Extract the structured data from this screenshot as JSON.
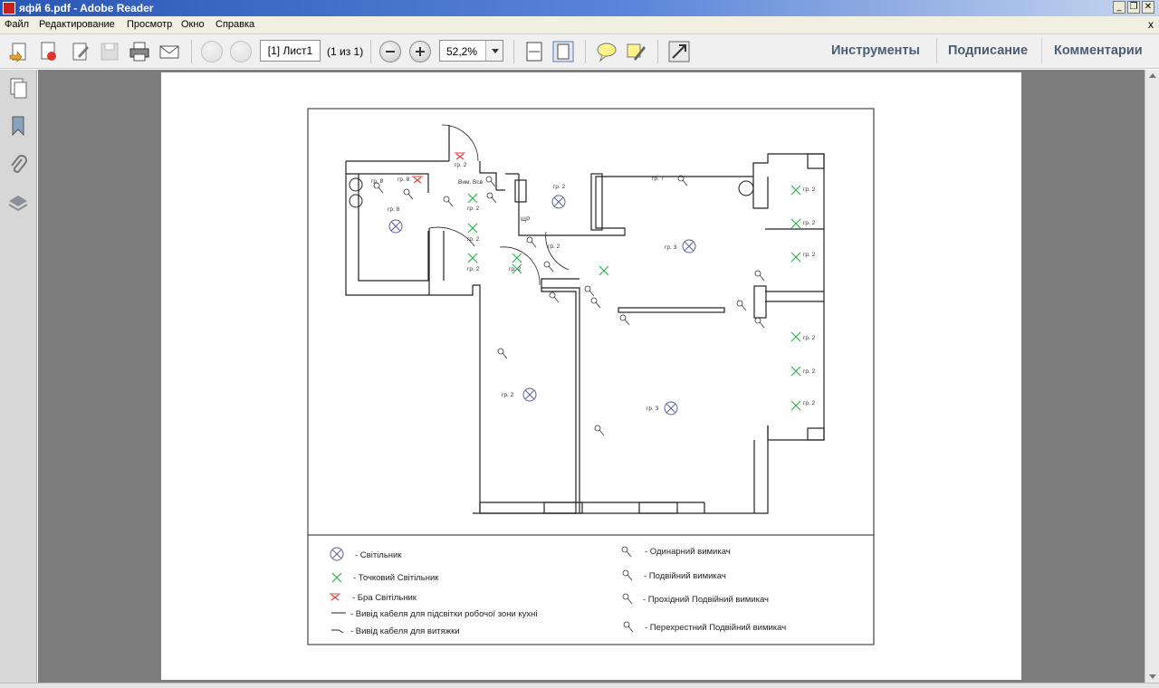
{
  "window": {
    "title": "яфй 6.pdf - Adobe Reader",
    "min": "_",
    "restore": "❐",
    "close": "✕"
  },
  "menu": {
    "items": [
      "Файл",
      "Редактирование",
      "Просмотр",
      "Окно",
      "Справка"
    ],
    "close_doc": "x"
  },
  "toolbar": {
    "page_field": "[1] Лист1",
    "page_count": "(1 из 1)",
    "zoom": "52,2%",
    "panels": [
      "Инструменты",
      "Подписание",
      "Комментарии"
    ]
  },
  "legend": {
    "items_left": [
      "- Світільник",
      "- Точковий Світільник",
      "- Бра Світільник",
      "- Вивід кабеля для підсвітки робочої зони кухні",
      "- Вивід кабеля для витяжки"
    ],
    "items_right": [
      "- Одинарний вимикач",
      "- Подвійний вимикач",
      "- Прохідний Подвійний вимикач",
      "- Перехрестний Подвійний вимикач"
    ]
  },
  "plan_labels": {
    "gr2": "гр. 2",
    "gr3": "гр. 3",
    "gr7": "гр. 7",
    "gr8": "гр. 8",
    "vim_vsv": "Вим. Всв",
    "shr": "ЩР"
  },
  "colors": {
    "spot": "#2db34a",
    "sconce": "#e0433a",
    "lamp": "#5a5f9a",
    "wall": "#222222",
    "accent_title": "#2a56b5"
  }
}
